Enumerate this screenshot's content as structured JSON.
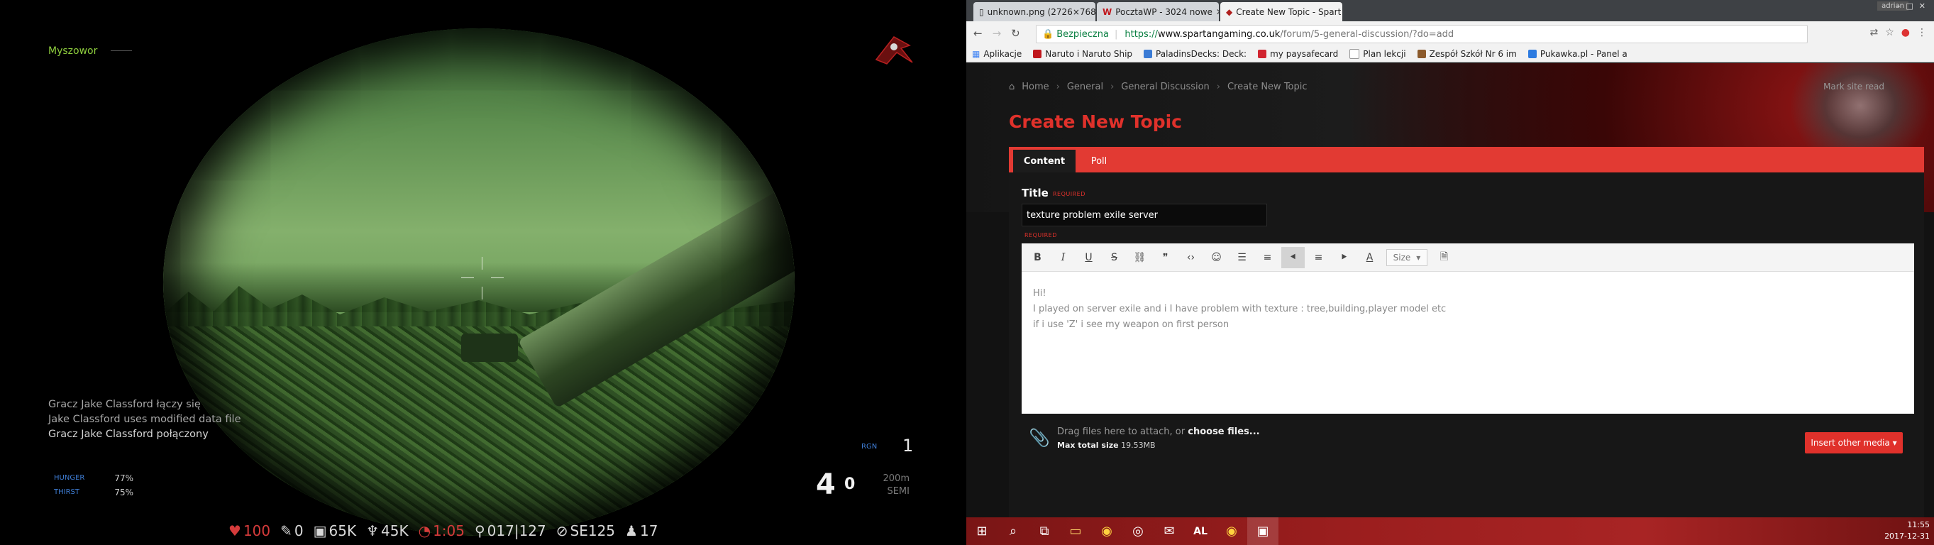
{
  "game": {
    "player_name": "Myszowor",
    "chat": [
      "Gracz Jake Classford łączy się",
      "Jake Classford uses modified data file",
      "Gracz Jake Classford połączony"
    ],
    "hunger_label": "HUNGER",
    "hunger_value": "77%",
    "thirst_label": "THIRST",
    "thirst_value": "75%",
    "rgn_label": "RGN",
    "rgn_value": "1",
    "ammo": "4",
    "magazines": "0",
    "zoom": "200m",
    "fire_mode": "SEMI",
    "hud": {
      "health": "100",
      "blood": "0",
      "money1": "65K",
      "money2": "45K",
      "clock": "1:05",
      "players": "017|127",
      "compass": "SE125",
      "group": "17"
    }
  },
  "browser": {
    "tabs": [
      {
        "title": "unknown.png (2726×768)"
      },
      {
        "title": "PocztaWP - 3024 nowe"
      },
      {
        "title": "Create New Topic - Spart"
      }
    ],
    "user": "adrian",
    "secure_label": "Bezpieczna",
    "url_scheme": "https://",
    "url_host": "www.spartangaming.co.uk",
    "url_rest": "/forum/5-general-discussion/?do=add",
    "bookmarks": [
      "Aplikacje",
      "Naruto i Naruto Ship",
      "PaladinsDecks: Deck:",
      "my paysafecard",
      "Plan lekcji",
      "Zespół Szkół Nr 6 im",
      "Pukawka.pl - Panel a"
    ],
    "breadcrumb": [
      "Home",
      "General",
      "General Discussion",
      "Create New Topic"
    ],
    "mark_read": "Mark site read",
    "page_title": "Create New Topic",
    "form_tabs": [
      "Content",
      "Poll"
    ],
    "title_label": "Title",
    "required": "REQUIRED",
    "title_value": "texture problem exile server",
    "size_label": "Size",
    "editor_lines": [
      "Hi!",
      "I played on server exile and i I have problem with texture : tree,building,player model etc",
      "if i use 'Z' i see my weapon on first person"
    ],
    "attach_text": "Drag files here to attach, or",
    "attach_link": "choose files...",
    "max_size_label": "Max total size",
    "max_size_value": "19.53MB",
    "insert_media": "Insert other media ▾",
    "clock_time": "11:55",
    "clock_date": "2017-12-31"
  }
}
